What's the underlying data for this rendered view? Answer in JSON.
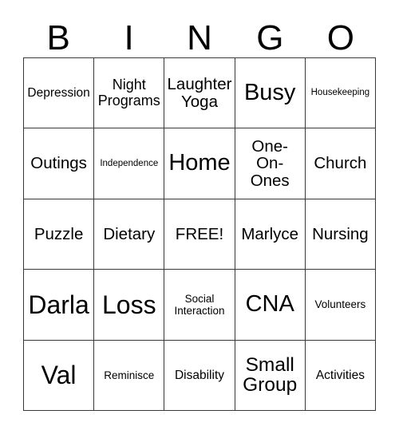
{
  "card": {
    "title_letters": [
      "B",
      "I",
      "N",
      "G",
      "O"
    ],
    "free_space_label": "FREE!",
    "colors": {
      "background": "#ffffff",
      "grid_line": "#3a3a3a",
      "text": "#000000"
    },
    "rows": [
      [
        {
          "text": "Depression",
          "size": "sz-sm"
        },
        {
          "text": "Night\nPrograms",
          "size": "sz-m"
        },
        {
          "text": "Laughter\nYoga",
          "size": "sz-ml"
        },
        {
          "text": "Busy",
          "size": "sz-xl"
        },
        {
          "text": "Housekeeping",
          "size": "sz-xs"
        }
      ],
      [
        {
          "text": "Outings",
          "size": "sz-ml"
        },
        {
          "text": "Independence",
          "size": "sz-xs"
        },
        {
          "text": "Home",
          "size": "sz-xl"
        },
        {
          "text": "One-\nOn-\nOnes",
          "size": "sz-ml"
        },
        {
          "text": "Church",
          "size": "sz-ml"
        }
      ],
      [
        {
          "text": "Puzzle",
          "size": "sz-ml"
        },
        {
          "text": "Dietary",
          "size": "sz-ml"
        },
        {
          "text": "FREE!",
          "size": "sz-ml"
        },
        {
          "text": "Marlyce",
          "size": "sz-ml"
        },
        {
          "text": "Nursing",
          "size": "sz-ml"
        }
      ],
      [
        {
          "text": "Darla",
          "size": "sz-xxl"
        },
        {
          "text": "Loss",
          "size": "sz-xxl"
        },
        {
          "text": "Social\nInteraction",
          "size": "sz-s"
        },
        {
          "text": "CNA",
          "size": "sz-xl"
        },
        {
          "text": "Volunteers",
          "size": "sz-s"
        }
      ],
      [
        {
          "text": "Val",
          "size": "sz-xxl"
        },
        {
          "text": "Reminisce",
          "size": "sz-s"
        },
        {
          "text": "Disability",
          "size": "sz-sm"
        },
        {
          "text": "Small\nGroup",
          "size": "sz-l"
        },
        {
          "text": "Activities",
          "size": "sz-sm"
        }
      ]
    ]
  }
}
